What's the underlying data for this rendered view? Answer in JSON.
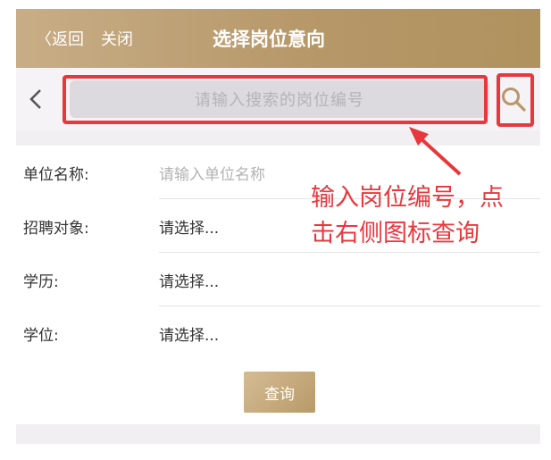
{
  "nav": {
    "back_label": "〈返回",
    "close_label": "关闭",
    "title": "选择岗位意向"
  },
  "search": {
    "placeholder": "请输入搜索的岗位编号"
  },
  "form": {
    "rows": [
      {
        "label": "单位名称:",
        "value": "请输入单位名称",
        "is_placeholder": true
      },
      {
        "label": "招聘对象:",
        "value": "请选择...",
        "is_placeholder": false
      },
      {
        "label": "学历:",
        "value": "请选择...",
        "is_placeholder": false
      },
      {
        "label": "学位:",
        "value": "请选择...",
        "is_placeholder": false
      }
    ],
    "query_label": "查询"
  },
  "annotation": {
    "line1": "输入岗位编号，点",
    "line2": "击右侧图标查询",
    "color": "#e8383d"
  },
  "colors": {
    "nav_bg": "#b69869",
    "accent_red": "#e8383d",
    "button_bg": "#c8ad86"
  },
  "icons": {
    "back": "chevron-left-icon",
    "search": "search-icon"
  }
}
